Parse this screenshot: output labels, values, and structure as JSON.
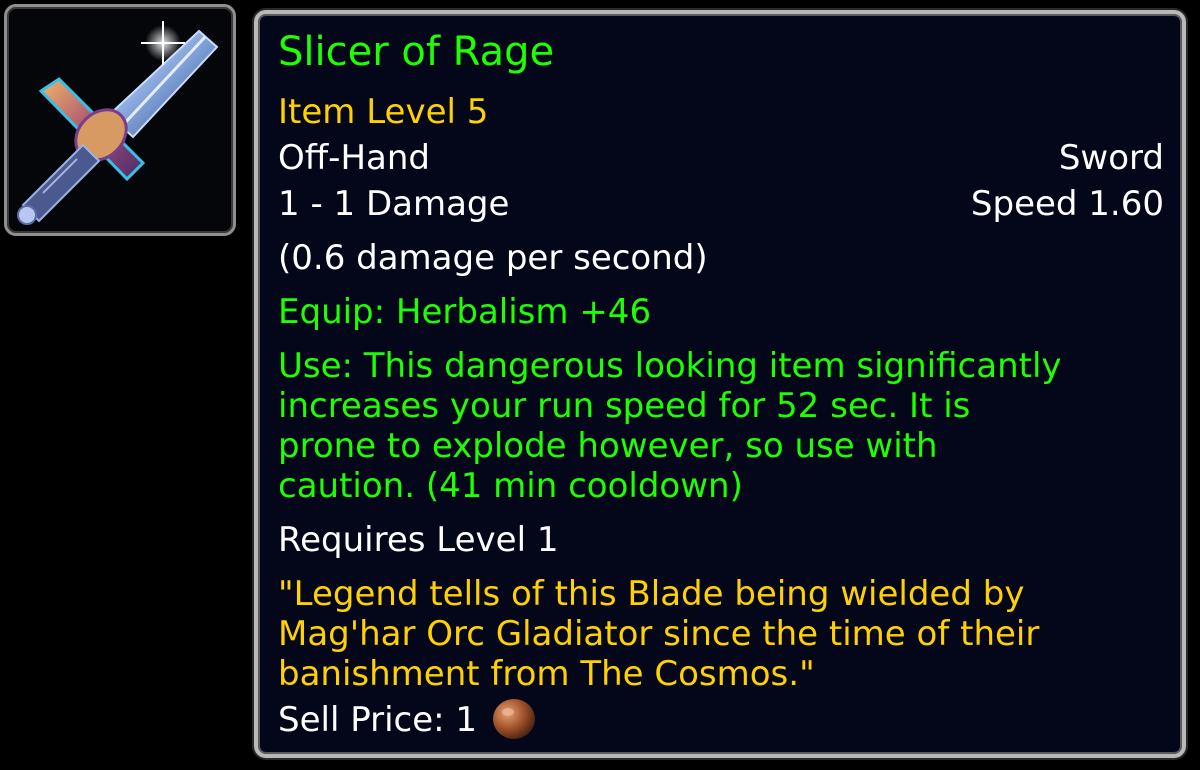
{
  "item": {
    "name": "Slicer of Rage",
    "item_level": "Item Level 5",
    "slot": "Off-Hand",
    "type": "Sword",
    "damage": "1 - 1 Damage",
    "speed": "Speed 1.60",
    "dps": "(0.6 damage per second)",
    "equip": "Equip: Herbalism +46",
    "use_lines": [
      "Use: This dangerous looking item significantly",
      "increases your run speed for 52 sec. It is",
      "prone to explode however, so use with",
      "caution. (41 min cooldown)"
    ],
    "requires": "Requires Level 1",
    "flavor_lines": [
      "\"Legend tells of this Blade being wielded by",
      "Mag'har Orc Gladiator since the time of their",
      "banishment from The Cosmos.\""
    ],
    "sell_price_label": "Sell Price: 1",
    "sell_coin_icon": "copper-coin-icon",
    "item_icon": "sword-icon"
  },
  "colors": {
    "name_quality": "#1eff00",
    "item_level": "#ffd100",
    "stat_text": "#ffffff",
    "effect_text": "#1eff00",
    "flavor_text": "#ffd100",
    "background": "#04071a",
    "border": "#b9b9b9"
  }
}
